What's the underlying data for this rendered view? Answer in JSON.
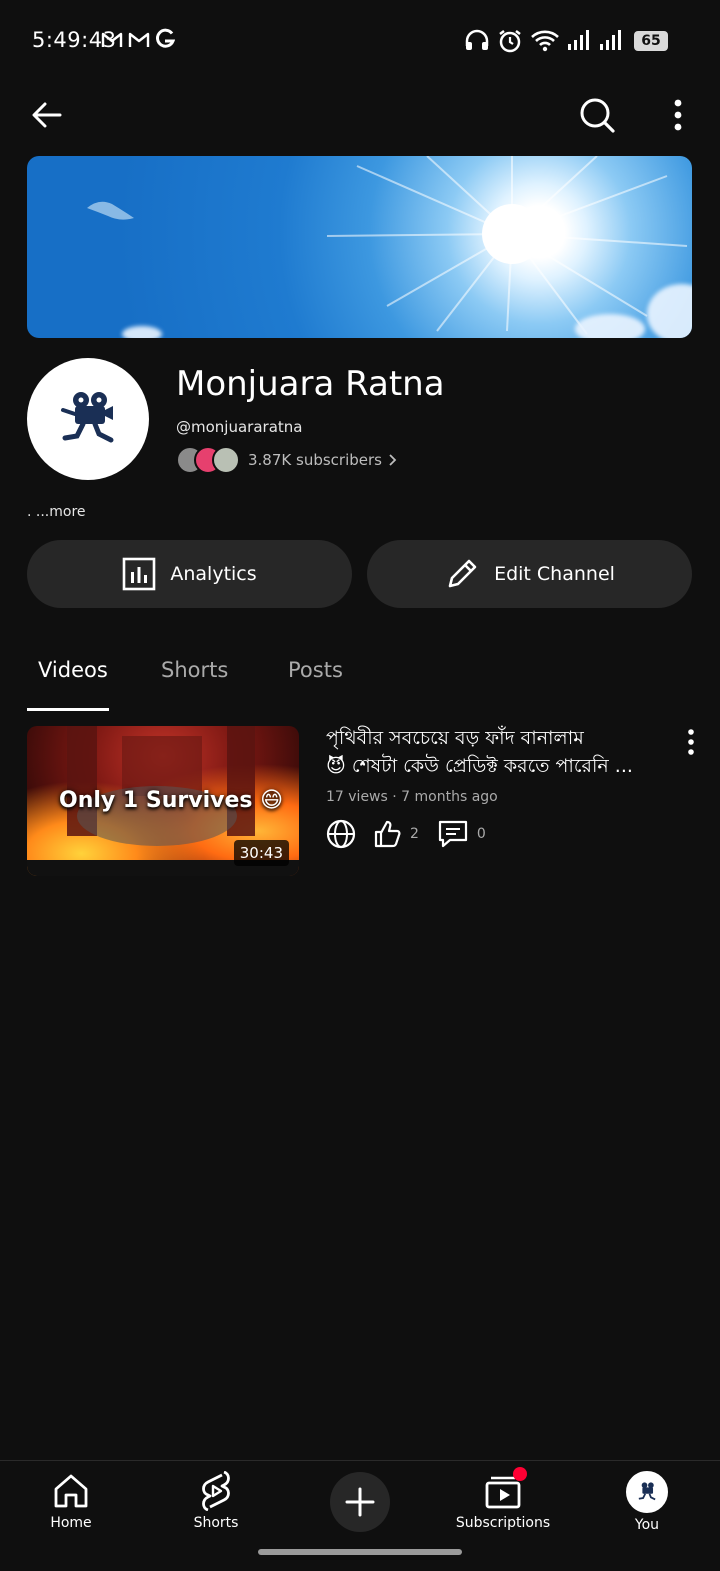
{
  "status_bar": {
    "time": "5:49:43",
    "notifications": [
      "gmail-icon",
      "gmail-icon",
      "google-icon"
    ],
    "battery": "65"
  },
  "channel": {
    "name": "Monjuara Ratna",
    "handle": "@monjuararatna",
    "subscribers": "3.87K subscribers",
    "more": ". ...more"
  },
  "actions": {
    "analytics": "Analytics",
    "edit_channel": "Edit Channel"
  },
  "tabs": [
    {
      "label": "Videos",
      "active": true
    },
    {
      "label": "Shorts",
      "active": false
    },
    {
      "label": "Posts",
      "active": false
    }
  ],
  "videos": [
    {
      "thumbnail_text": "Only 1 Survives 😄",
      "duration": "30:43",
      "title_line1": "পৃথিবীর সবচেয়ে বড় ফাঁদ বানালাম",
      "title_line2": "😈  শেষটা কেউ প্রেডিক্ট করতে পারেনি ...",
      "meta": "17 views · 7 months ago",
      "likes": "2",
      "comments": "0"
    }
  ],
  "bottom_nav": {
    "home": "Home",
    "shorts": "Shorts",
    "subscriptions": "Subscriptions",
    "you": "You"
  },
  "colors": {
    "background": "#0f0f0f",
    "surface": "#272727",
    "notification_dot": "#ff0033",
    "mini_avatar_accent": "#e6406e"
  }
}
